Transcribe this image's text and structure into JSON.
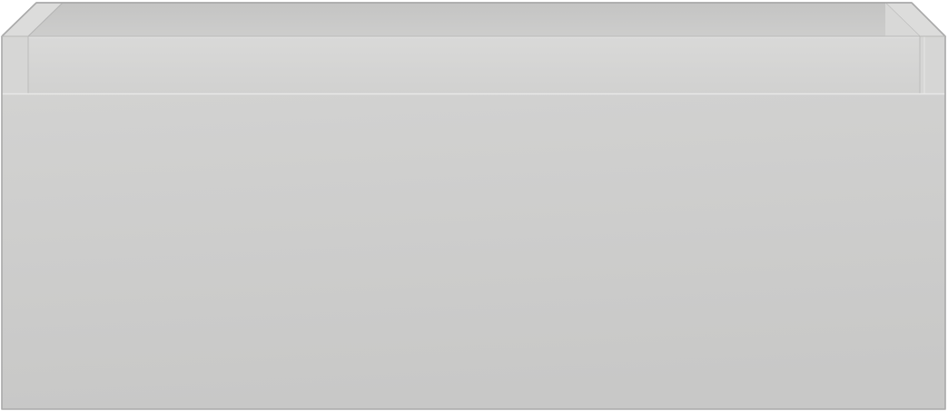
{
  "image": {
    "subject": "drawer-box",
    "colors": {
      "background": "#ffffff",
      "front_panel_top": "#d2d2d1",
      "front_panel_bottom": "#c8c8c7",
      "rim_top": "#d6d6d5",
      "inner_back_wall": "#c9c9c8",
      "inner_side_wall": "#dcdcdb",
      "outline": "#a9a9a9"
    }
  }
}
